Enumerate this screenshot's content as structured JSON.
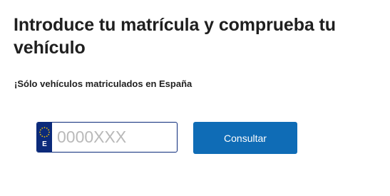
{
  "header": {
    "title": "Introduce tu matrícula y comprueba tu vehículo",
    "subtitle": "¡Sólo vehículos matriculados en España"
  },
  "plate": {
    "country_code": "E",
    "eu_icon": "eu-stars-icon",
    "input_value": "",
    "placeholder": "0000XXX"
  },
  "actions": {
    "submit_label": "Consultar"
  },
  "colors": {
    "button_bg": "#0f6cb6",
    "plate_band": "#0b2a7a",
    "eu_stars": "#f5c400",
    "placeholder": "#b9b9b9"
  }
}
